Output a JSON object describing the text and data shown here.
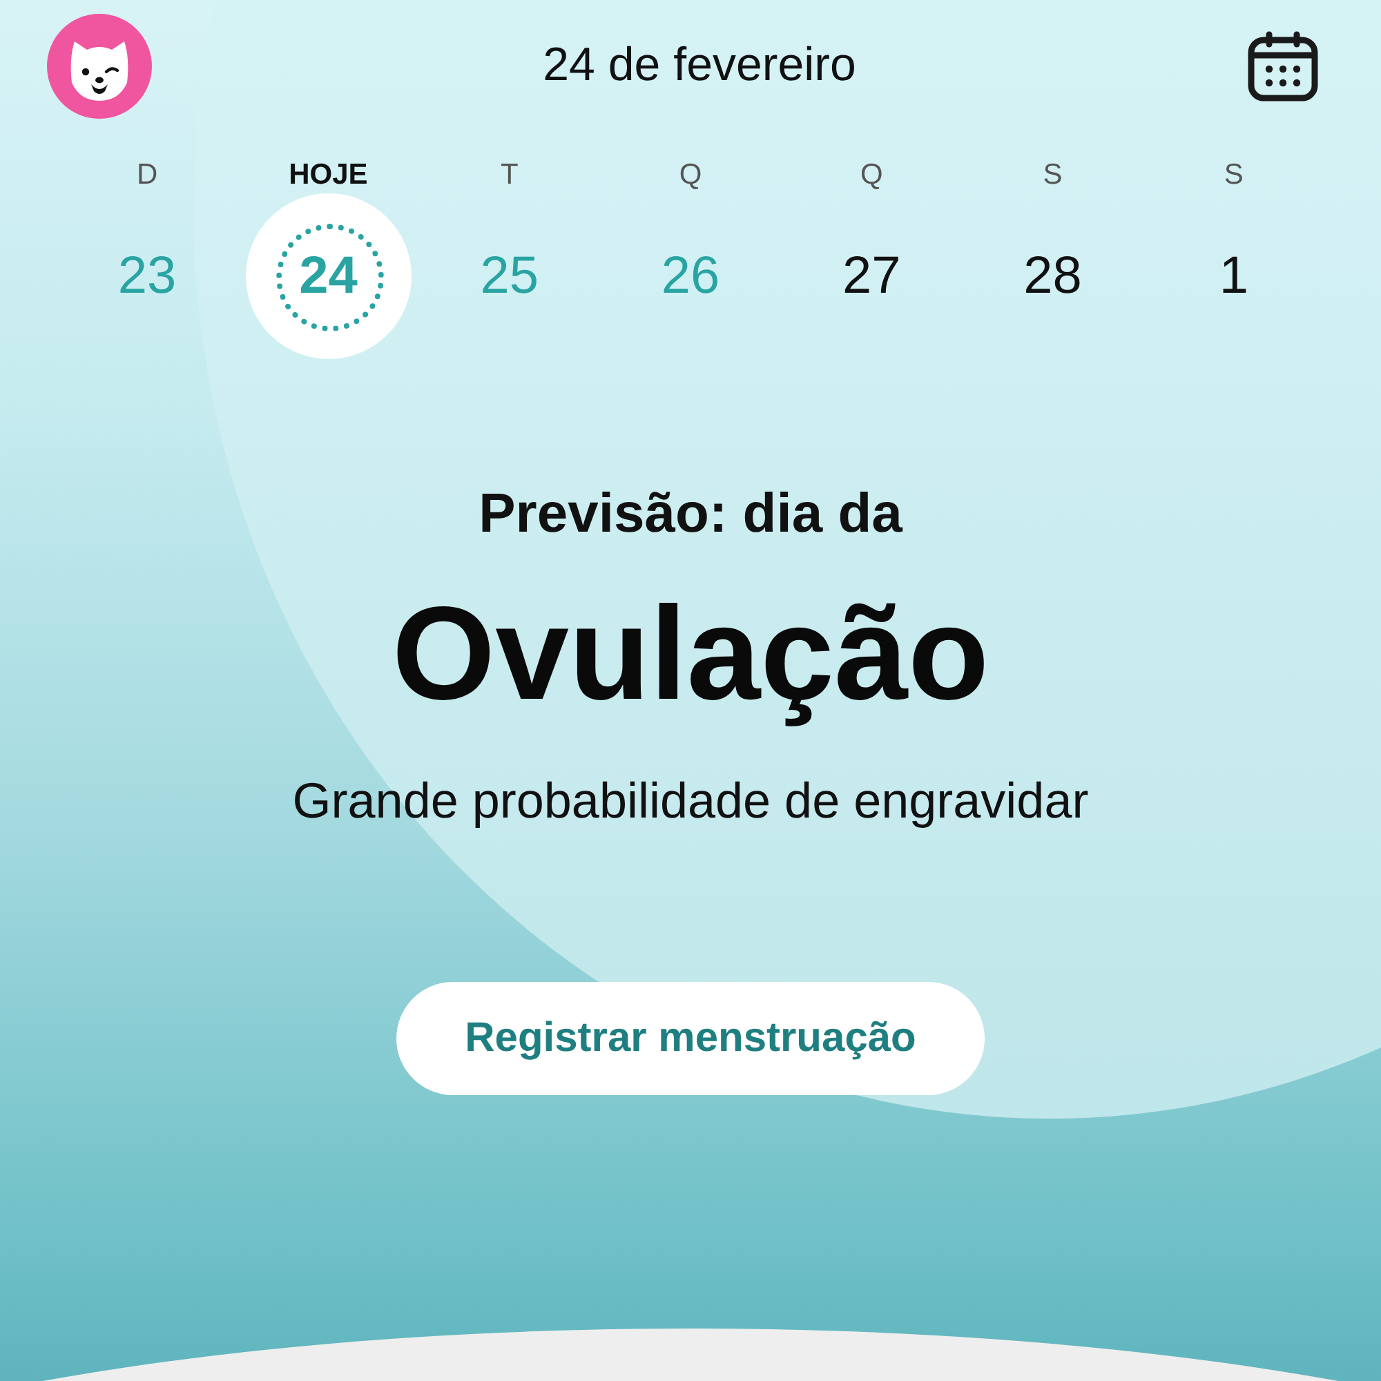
{
  "header": {
    "title": "24 de fevereiro"
  },
  "week": [
    {
      "weekday": "D",
      "day": "23",
      "selected": false,
      "fertile": true
    },
    {
      "weekday": "HOJE",
      "day": "24",
      "selected": true,
      "fertile": true
    },
    {
      "weekday": "T",
      "day": "25",
      "selected": false,
      "fertile": true
    },
    {
      "weekday": "Q",
      "day": "26",
      "selected": false,
      "fertile": true
    },
    {
      "weekday": "Q",
      "day": "27",
      "selected": false,
      "fertile": false
    },
    {
      "weekday": "S",
      "day": "28",
      "selected": false,
      "fertile": false
    },
    {
      "weekday": "S",
      "day": "1",
      "selected": false,
      "fertile": false
    }
  ],
  "prediction": {
    "label": "Previsão: dia da",
    "phase": "Ovulação",
    "description": "Grande probabilidade de engravidar"
  },
  "action_button": "Registrar menstruação"
}
